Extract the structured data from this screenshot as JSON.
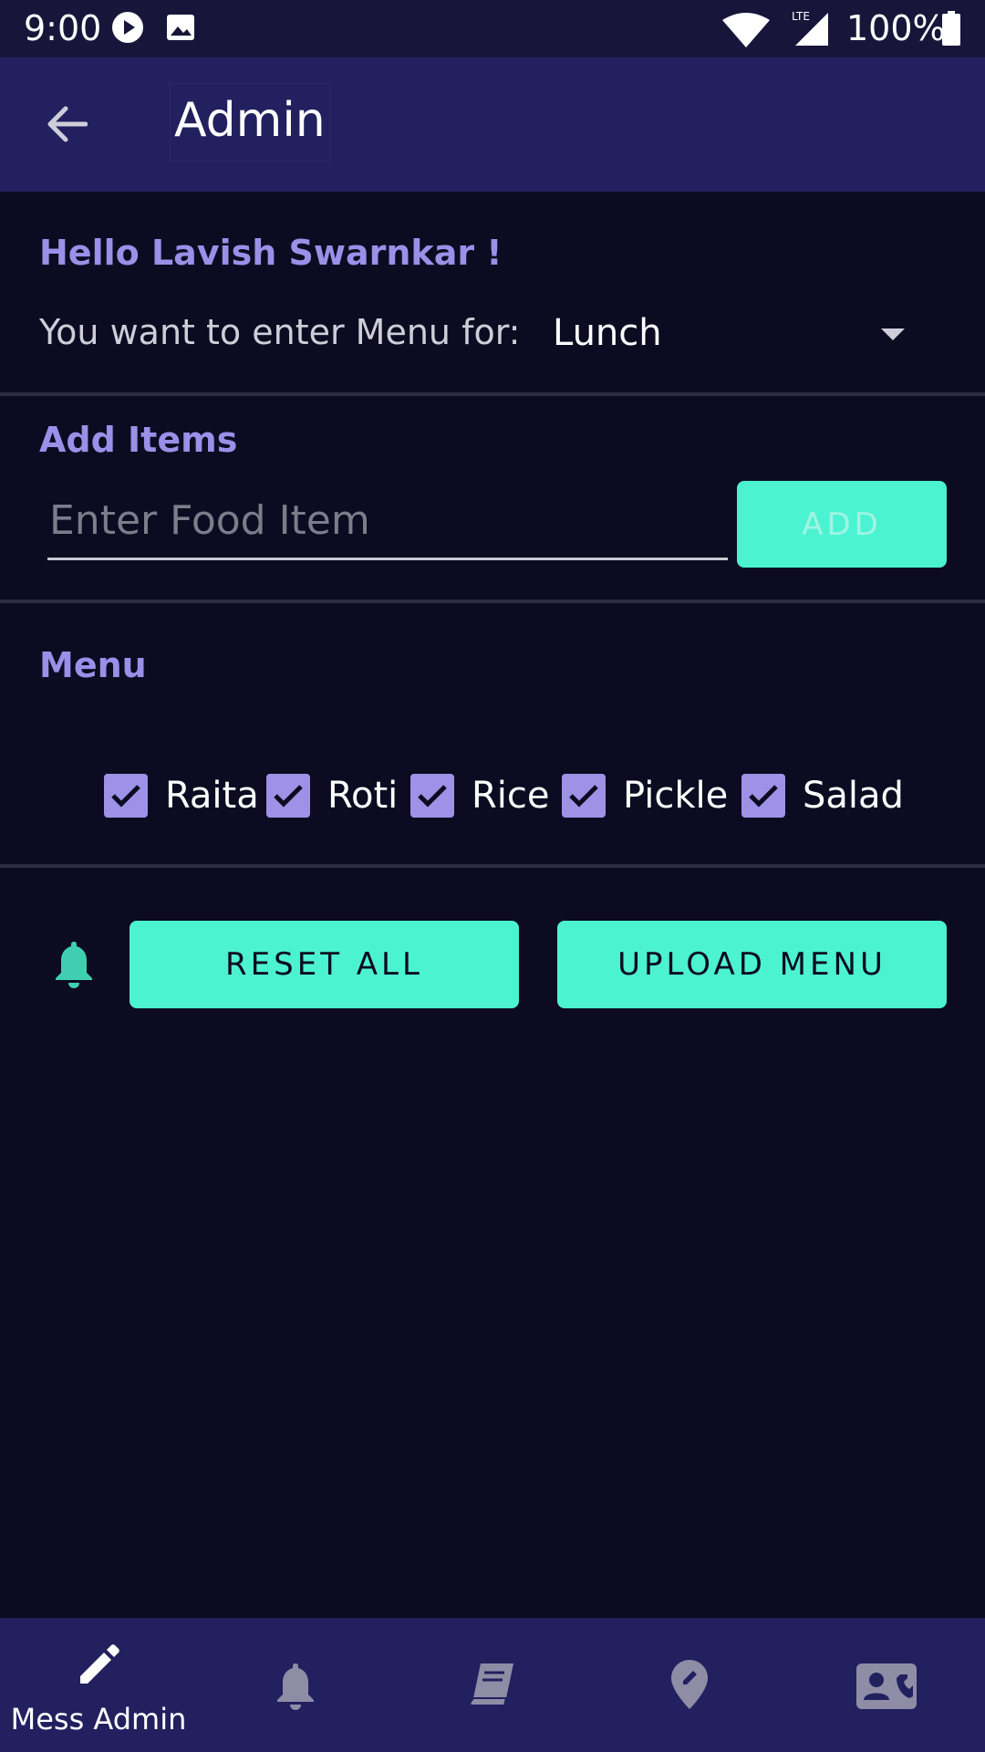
{
  "status_bar": {
    "time": "9:00",
    "battery": "100%"
  },
  "app_bar": {
    "title": "Admin"
  },
  "greeting": "Hello Lavish Swarnkar !",
  "meal_select": {
    "label": "You want to enter Menu for:",
    "value": "Lunch"
  },
  "add_items": {
    "title": "Add Items",
    "input_placeholder": "Enter Food Item",
    "input_value": "",
    "add_button": "ADD"
  },
  "menu": {
    "title": "Menu",
    "items": [
      {
        "label": "Raita",
        "checked": true
      },
      {
        "label": "Roti",
        "checked": true
      },
      {
        "label": "Rice",
        "checked": true
      },
      {
        "label": "Pickle",
        "checked": true
      },
      {
        "label": "Salad",
        "checked": true
      }
    ]
  },
  "actions": {
    "reset": "RESET ALL",
    "upload": "UPLOAD MENU"
  },
  "bottom_nav": {
    "items": [
      {
        "icon": "pencil-icon",
        "label": "Mess Admin",
        "active": true
      },
      {
        "icon": "bell-icon",
        "label": ""
      },
      {
        "icon": "book-icon",
        "label": ""
      },
      {
        "icon": "map-pin-icon",
        "label": ""
      },
      {
        "icon": "contact-card-icon",
        "label": ""
      }
    ]
  },
  "colors": {
    "background": "#0c0b21",
    "appbar": "#22205f",
    "accent": "#4cf3d2",
    "heading": "#9b8fe8",
    "checkbox": "#9f91e6"
  }
}
